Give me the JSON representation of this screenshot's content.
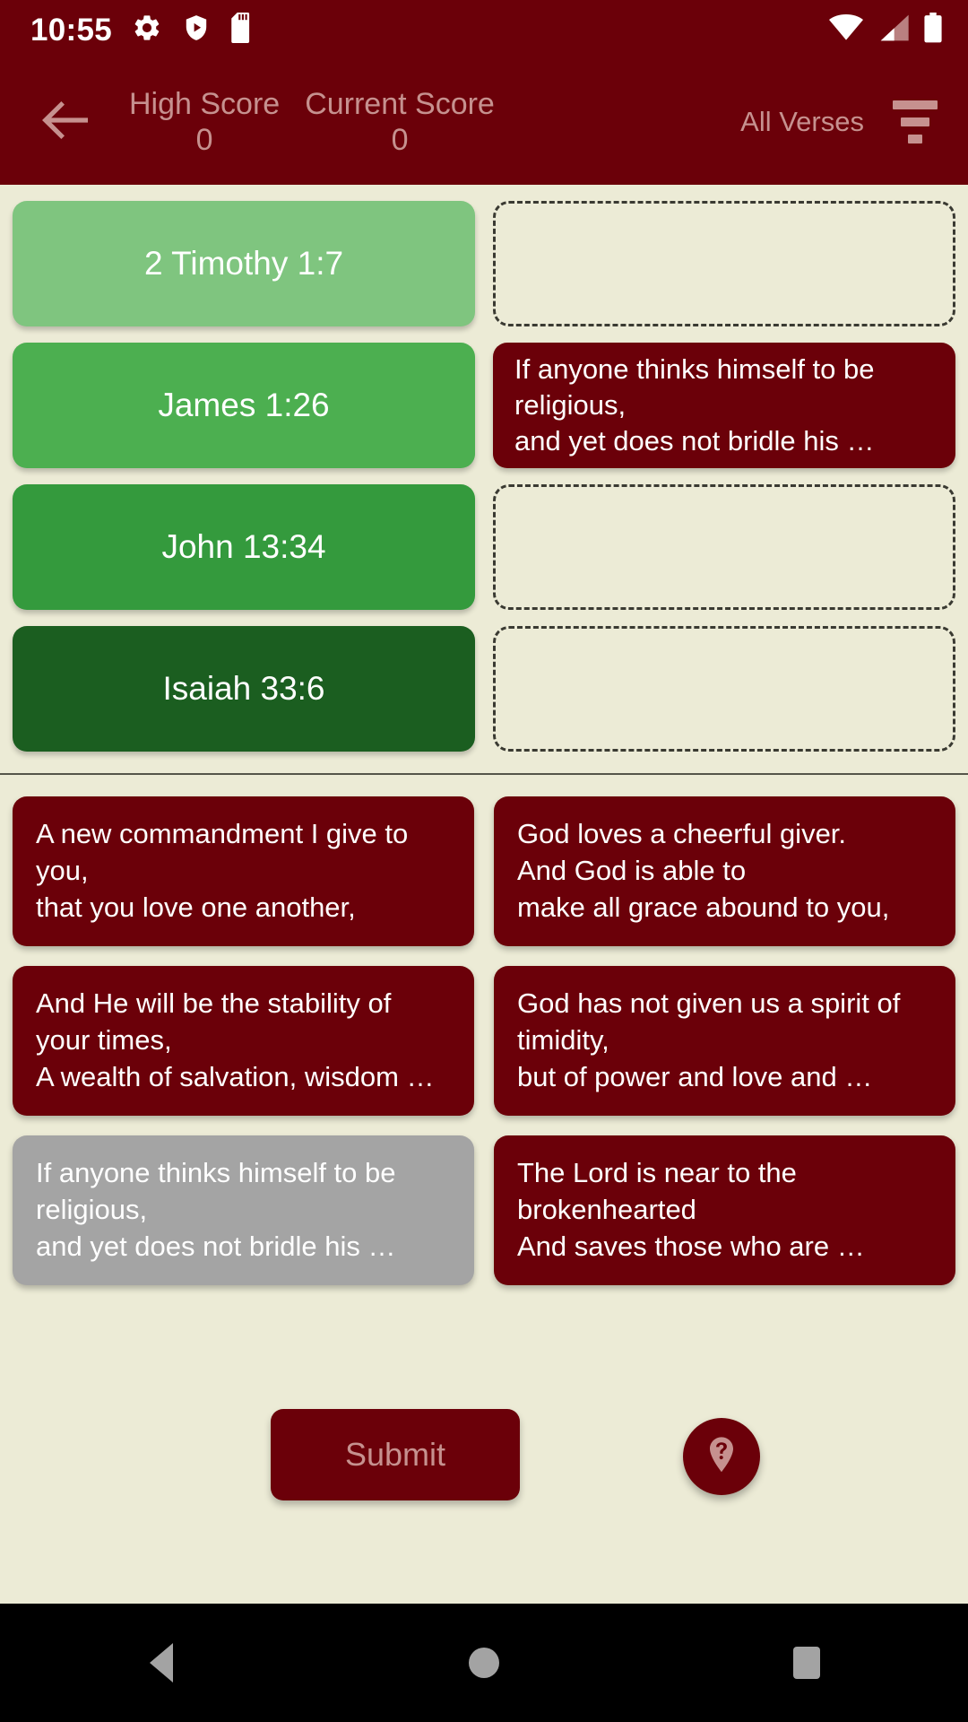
{
  "status_bar": {
    "time": "10:55",
    "left_icons": [
      "gear-icon",
      "shield-play-icon",
      "sd-card-icon"
    ],
    "right_icons": [
      "wifi-icon",
      "cell-signal-icon",
      "battery-icon"
    ]
  },
  "app_bar": {
    "back_icon": "arrow-left-icon",
    "high_score_label": "High Score",
    "high_score_value": "0",
    "current_score_label": "Current Score",
    "current_score_value": "0",
    "filter_label": "All Verses",
    "filter_icon": "filter-icon",
    "background_color": "#6B0009",
    "text_color": "#C6918F"
  },
  "match_rows": [
    {
      "reference": "2 Timothy 1:7",
      "card_color": "#7FC57F",
      "answer": "",
      "filled": false
    },
    {
      "reference": "James 1:26",
      "card_color": "#4CAF50",
      "answer": "If anyone thinks himself to be religious,\n and yet does not bridle his …",
      "filled": true
    },
    {
      "reference": "John 13:34",
      "card_color": "#349A3D",
      "answer": "",
      "filled": false
    },
    {
      "reference": "Isaiah 33:6",
      "card_color": "#1B5E20",
      "answer": "",
      "filled": false
    }
  ],
  "options": [
    {
      "text": "A new commandment I give to you,\n that you love one another,",
      "used": false
    },
    {
      "text": "God loves a cheerful giver.\nAnd God is able to\nmake all grace abound to you,",
      "used": false
    },
    {
      "text": "And He will be the stability of your times,\nA wealth  of salvation, wisdom …",
      "used": false
    },
    {
      "text": "God has not given us a spirit of timidity,\nbut of power and love and …",
      "used": false
    },
    {
      "text": "If anyone thinks himself to be religious,\n and yet does not bridle his …",
      "used": true
    },
    {
      "text": "The Lord is near to the brokenhearted\n And saves those who are …",
      "used": false
    }
  ],
  "footer": {
    "submit_label": "Submit",
    "help_icon": "help-pin-icon"
  },
  "nav_bar": {
    "back": "nav-back-icon",
    "home": "nav-home-icon",
    "recents": "nav-recents-icon"
  },
  "colors": {
    "brand_red": "#6B0009",
    "background": "#ECEBD6",
    "muted_rose": "#C6918F",
    "used_grey": "#A4A4A4"
  }
}
